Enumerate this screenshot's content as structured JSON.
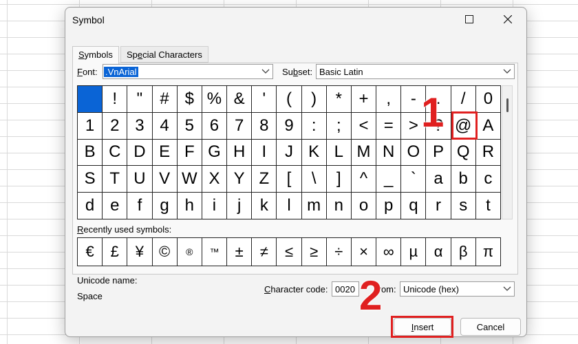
{
  "dialog": {
    "title": "Symbol"
  },
  "tabs": [
    {
      "label": "Symbols",
      "underline": "S",
      "rest": "ymbols"
    },
    {
      "label": "Special Characters",
      "pre": "Sp",
      "underline": "e",
      "rest": "cial Characters"
    }
  ],
  "font": {
    "label_u": "F",
    "label_rest": "ont:",
    "value": ".VnArial"
  },
  "subset": {
    "label_pre": "Su",
    "label_u": "b",
    "label_rest": "set:",
    "value": "Basic Latin"
  },
  "symbols": [
    " ",
    "!",
    "\"",
    "#",
    "$",
    "%",
    "&",
    "'",
    "(",
    ")",
    "*",
    "+",
    ",",
    "-",
    ".",
    "/",
    "0",
    "1",
    "2",
    "3",
    "4",
    "5",
    "6",
    "7",
    "8",
    "9",
    ":",
    ";",
    "<",
    "=",
    ">",
    "?",
    "@",
    "A",
    "B",
    "C",
    "D",
    "E",
    "F",
    "G",
    "H",
    "I",
    "J",
    "K",
    "L",
    "M",
    "N",
    "O",
    "P",
    "Q",
    "R",
    "S",
    "T",
    "U",
    "V",
    "W",
    "X",
    "Y",
    "Z",
    "[",
    "\\",
    "]",
    "^",
    "_",
    "`",
    "a",
    "b",
    "c",
    "d",
    "e",
    "f",
    "g",
    "h",
    "i",
    "j",
    "k",
    "l",
    "m",
    "n",
    "o",
    "p",
    "q",
    "r",
    "s",
    "t"
  ],
  "recent": {
    "label_u": "R",
    "label_rest": "ecently used symbols:",
    "items": [
      "€",
      "£",
      "¥",
      "©",
      "®",
      "™",
      "±",
      "≠",
      "≤",
      "≥",
      "÷",
      "×",
      "∞",
      "µ",
      "α",
      "β",
      "π"
    ]
  },
  "unicode_name": {
    "label": "Unicode name:",
    "value": "Space"
  },
  "char_code": {
    "label_u": "C",
    "label_rest": "haracter code:",
    "value": "0020"
  },
  "from": {
    "label": "from:",
    "value": "Unicode (hex)"
  },
  "buttons": {
    "insert": "Insert",
    "insert_u": "I",
    "insert_rest": "nsert",
    "cancel": "Cancel"
  },
  "annotations": {
    "step1": "1",
    "step2": "2"
  },
  "colors": {
    "highlight": "#e02020",
    "selection": "#0a64d6"
  }
}
